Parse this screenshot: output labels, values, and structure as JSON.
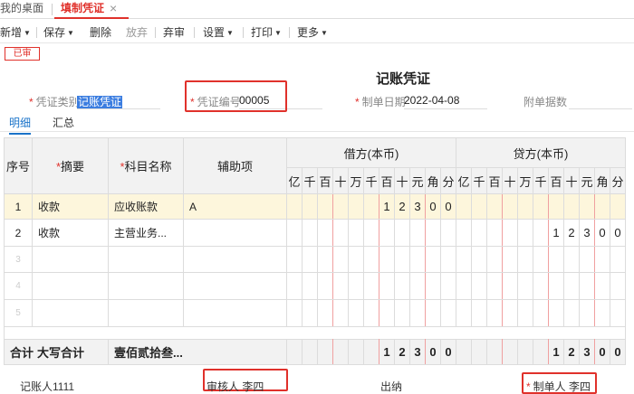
{
  "tabs": [
    {
      "label": "我的桌面"
    },
    {
      "label": "填制凭证"
    }
  ],
  "toolbar": {
    "items": [
      "新增",
      "保存",
      "删除",
      "放弃",
      "弃审",
      "设置",
      "打印",
      "更多"
    ]
  },
  "status_stamp": "已审",
  "voucher_title": "记账凭证",
  "header": {
    "voucher_type_label": "凭证类别",
    "voucher_type_value": "记账凭证",
    "voucher_no_label": "凭证编号",
    "voucher_no_value": "00005",
    "date_label": "制单日期",
    "date_value": "2022-04-08",
    "attachments_label": "附单据数"
  },
  "subtabs": [
    "明细",
    "汇总"
  ],
  "table": {
    "col_seq": "序号",
    "col_summary": "摘要",
    "col_account": "科目名称",
    "col_aux": "辅助项",
    "debit_header": "借方(本币)",
    "credit_header": "贷方(本币)",
    "digit_units": [
      "亿",
      "千",
      "百",
      "十",
      "万",
      "千",
      "百",
      "十",
      "元",
      "角",
      "分"
    ],
    "rows": [
      {
        "seq": "1",
        "summary": "收款",
        "account": "应收账款",
        "aux": "A",
        "debit": [
          "",
          "",
          "",
          "",
          "",
          "",
          "1",
          "2",
          "3",
          "0",
          "0"
        ],
        "credit": [
          "",
          "",
          "",
          "",
          "",
          "",
          "",
          "",
          "",
          "",
          ""
        ]
      },
      {
        "seq": "2",
        "summary": "收款",
        "account": "主营业务...",
        "aux": "",
        "debit": [
          "",
          "",
          "",
          "",
          "",
          "",
          "",
          "",
          "",
          "",
          ""
        ],
        "credit": [
          "",
          "",
          "",
          "",
          "",
          "",
          "1",
          "2",
          "3",
          "0",
          "0"
        ]
      },
      {
        "seq": "3",
        "summary": "",
        "account": "",
        "aux": "",
        "debit": [
          "",
          "",
          "",
          "",
          "",
          "",
          "",
          "",
          "",
          "",
          ""
        ],
        "credit": [
          "",
          "",
          "",
          "",
          "",
          "",
          "",
          "",
          "",
          "",
          ""
        ]
      },
      {
        "seq": "4",
        "summary": "",
        "account": "",
        "aux": "",
        "debit": [
          "",
          "",
          "",
          "",
          "",
          "",
          "",
          "",
          "",
          "",
          ""
        ],
        "credit": [
          "",
          "",
          "",
          "",
          "",
          "",
          "",
          "",
          "",
          "",
          ""
        ]
      },
      {
        "seq": "5",
        "summary": "",
        "account": "",
        "aux": "",
        "debit": [
          "",
          "",
          "",
          "",
          "",
          "",
          "",
          "",
          "",
          "",
          ""
        ],
        "credit": [
          "",
          "",
          "",
          "",
          "",
          "",
          "",
          "",
          "",
          "",
          ""
        ]
      }
    ],
    "total": {
      "label": "合计",
      "amount_words_label": "大写合计",
      "amount_words": "壹佰贰拾叁...",
      "debit": [
        "",
        "",
        "",
        "",
        "",
        "",
        "1",
        "2",
        "3",
        "0",
        "0"
      ],
      "credit": [
        "",
        "",
        "",
        "",
        "",
        "",
        "1",
        "2",
        "3",
        "0",
        "0"
      ]
    }
  },
  "footer": {
    "bookkeeper": "记账人1111",
    "reviewer": "审核人 李四",
    "cashier": "出纳",
    "maker_label": "制单人",
    "maker_name": "李四"
  },
  "colors": {
    "accent": "#e0312b",
    "link": "#1a73c9",
    "selected_row": "#fdf6dc"
  },
  "icons": [
    "close-icon",
    "chevron-down-icon"
  ]
}
